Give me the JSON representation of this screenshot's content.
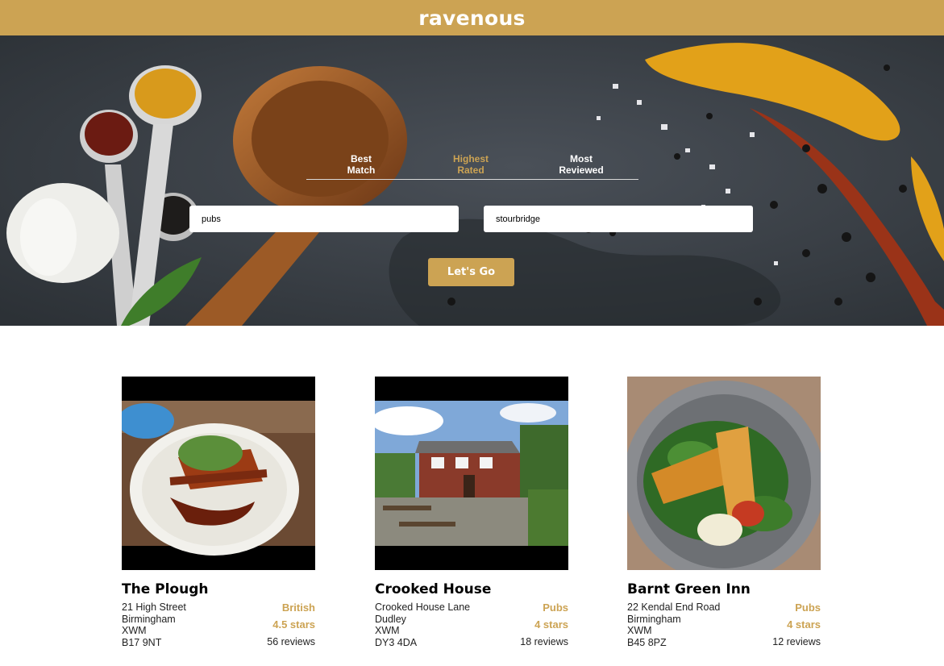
{
  "app": {
    "title": "ravenous"
  },
  "sort_options": [
    {
      "label": "Best\nMatch",
      "active": false
    },
    {
      "label": "Highest\nRated",
      "active": true
    },
    {
      "label": "Most\nReviewed",
      "active": false
    }
  ],
  "search": {
    "term_value": "pubs",
    "location_value": "stourbridge",
    "submit_label": "Let's Go"
  },
  "colors": {
    "brand": "#cca353",
    "hero_bg": "#3b4148"
  },
  "businesses": [
    {
      "name": "The Plough",
      "address": [
        "21 High Street",
        "Birmingham",
        "XWM",
        "B17 9NT"
      ],
      "category": "British",
      "rating": "4.5 stars",
      "reviews": "56 reviews"
    },
    {
      "name": "Crooked House",
      "address": [
        "Crooked House Lane",
        "Dudley",
        "XWM",
        "DY3 4DA"
      ],
      "category": "Pubs",
      "rating": "4 stars",
      "reviews": "18 reviews"
    },
    {
      "name": "Barnt Green Inn",
      "address": [
        "22 Kendal End Road",
        "Birmingham",
        "XWM",
        "B45 8PZ"
      ],
      "category": "Pubs",
      "rating": "4 stars",
      "reviews": "12 reviews"
    }
  ]
}
